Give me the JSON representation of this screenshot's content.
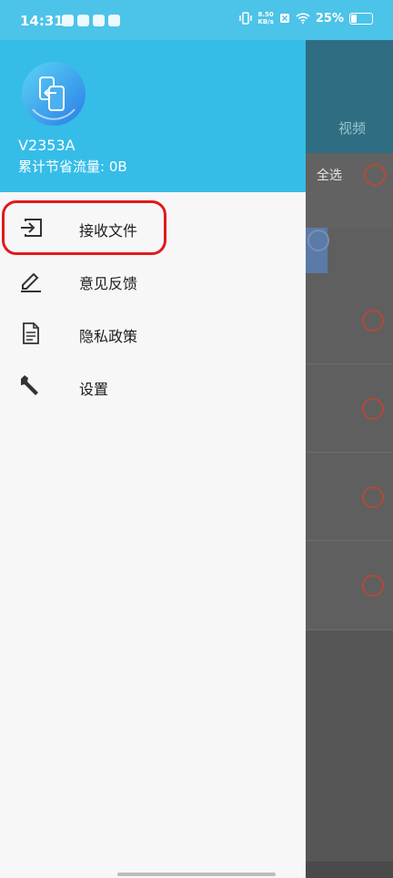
{
  "status_bar": {
    "time": "14:31",
    "net_speed_value": "8.50",
    "net_speed_unit": "KB/s",
    "battery_percent": "25%",
    "battery_level": 0.25
  },
  "drawer": {
    "device_name": "V2353A",
    "data_saved": "累计节省流量: 0B",
    "menu": [
      {
        "label": "接收文件",
        "icon": "receive-file-icon"
      },
      {
        "label": "意见反馈",
        "icon": "feedback-pen-icon"
      },
      {
        "label": "隐私政策",
        "icon": "document-icon"
      },
      {
        "label": "设置",
        "icon": "wrench-icon"
      }
    ]
  },
  "background_app": {
    "tab_video": "视频",
    "select_all": "全选"
  },
  "colors": {
    "header": "#35bde8",
    "highlight": "#e01b1b",
    "accent_circle": "#b24a3a"
  }
}
